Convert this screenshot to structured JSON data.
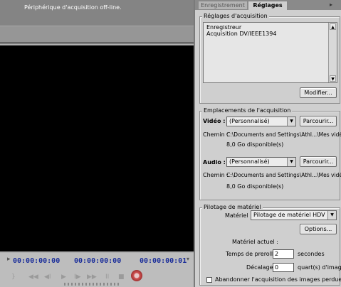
{
  "status_text": "Périphérique d'acquisition off-line.",
  "timecodes": {
    "in": "00:00:00:00",
    "out": "00:00:00:00",
    "duration": "00:00:00:01"
  },
  "transport": {
    "caret": "}",
    "buttons": [
      "◀◀",
      "◀I",
      "▶",
      "I▶",
      "▶▶",
      "II",
      "■"
    ],
    "scroll_glyph": "▾"
  },
  "tabs": {
    "record": "Enregistrement",
    "settings": "Réglages"
  },
  "capture_settings": {
    "title": "Réglages d'acquisition",
    "lines": [
      "Enregistreur",
      "Acquisition DV/IEEE1394"
    ],
    "modify_button": "Modifier..."
  },
  "capture_locations": {
    "title": "Emplacements de l'acquisition",
    "video": {
      "label": "Vidéo :",
      "select": "(Personnalisé)",
      "browse_button": "Parcourir...",
      "path_label": "Chemin :",
      "path": "C:\\Documents and Settings\\Athl...\\Mes vidéos",
      "free_space": "8,0 Go disponible(s)"
    },
    "audio": {
      "label": "Audio :",
      "select": "(Personnalisé)",
      "browse_button": "Parcourir...",
      "path_label": "Chemin :",
      "path": "C:\\Documents and Settings\\Athl...\\Mes vidéos",
      "free_space": "8,0 Go disponible(s)"
    }
  },
  "device_control": {
    "title": "Pilotage de matériel",
    "device_label": "Matériel :",
    "device_select": "Pilotage de matériel HDV",
    "options_button": "Options...",
    "current_device": "Matériel actuel :",
    "preroll_label": "Temps de preroll :",
    "preroll_value": "2",
    "preroll_unit": "secondes",
    "offset_label": "Décalage :",
    "offset_value": "0",
    "offset_unit": "quart(s) d'image",
    "abort_label": "Abandonner l'acquisition des images perdues"
  },
  "colors": {
    "timecode": "#1b2e9a",
    "monitor": "#000000",
    "panel": "#cfcfcf"
  }
}
